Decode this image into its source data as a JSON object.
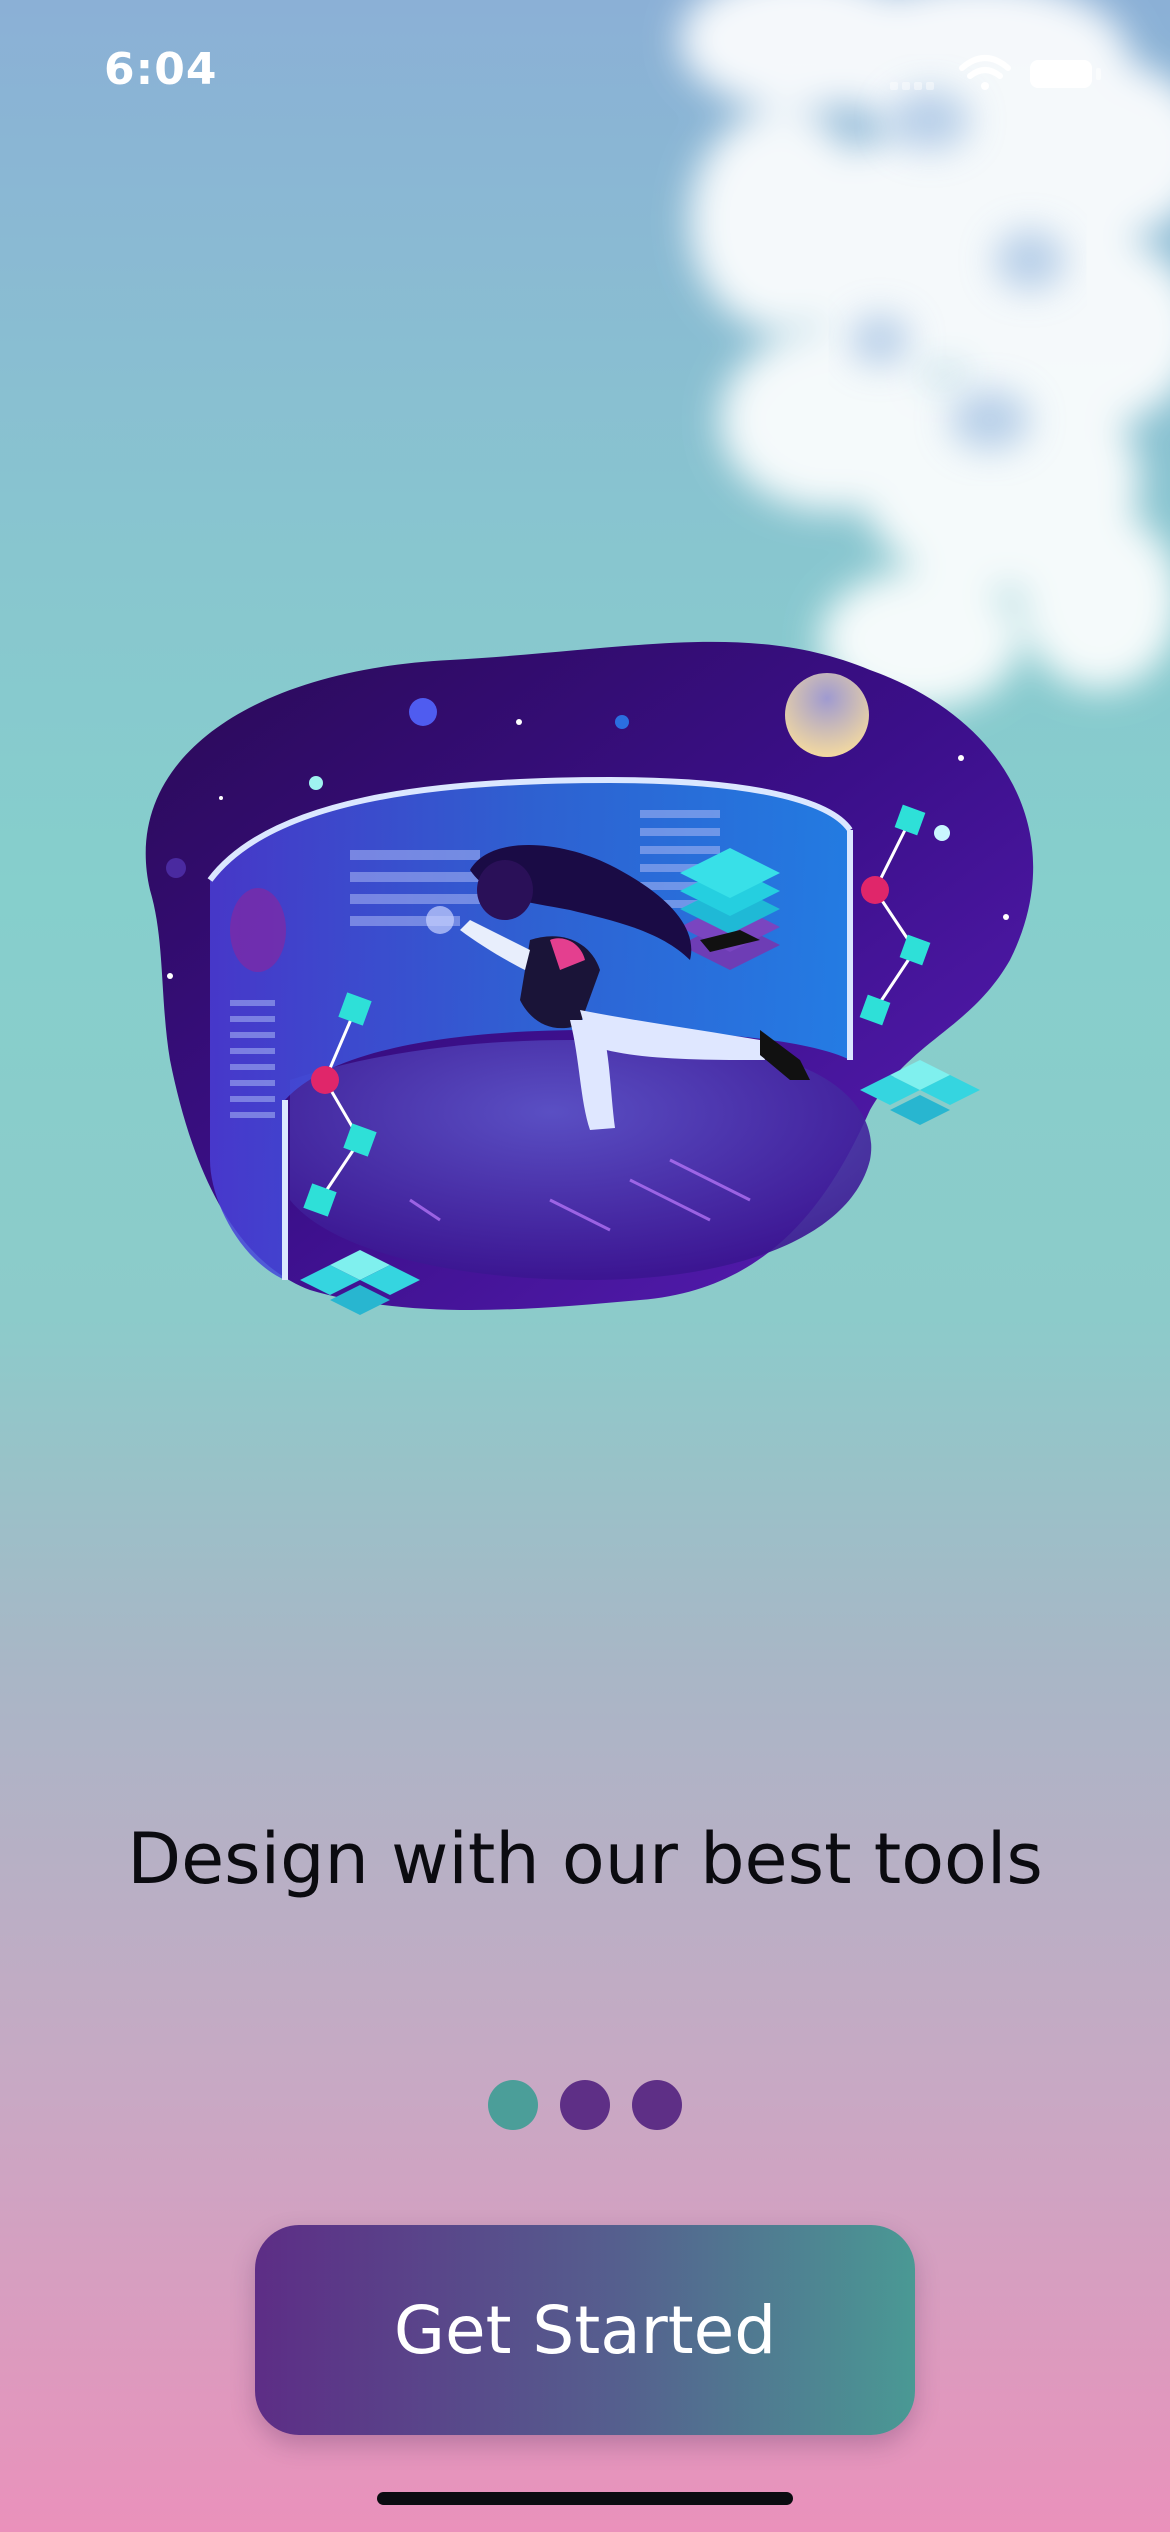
{
  "status_bar": {
    "time": "6:04"
  },
  "onboarding": {
    "headline": "Design with our best tools",
    "page_count": 3,
    "current_page": 1,
    "cta_label": "Get Started"
  },
  "colors": {
    "dot_active": "#4b9e99",
    "dot_inactive": "#5e2f86",
    "cta_start": "#5d2d86",
    "cta_end": "#4a9994"
  }
}
